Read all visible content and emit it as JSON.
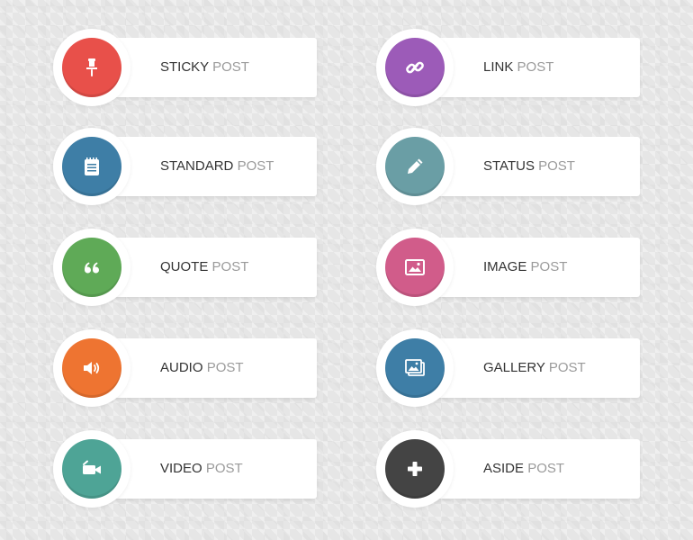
{
  "post_types": [
    {
      "key": "sticky",
      "name": "STICKY",
      "suffix": "POST",
      "icon": "pushpin-icon",
      "color": "#e8504a"
    },
    {
      "key": "link",
      "name": "LINK",
      "suffix": "POST",
      "icon": "link-icon",
      "color": "#9c5bb8"
    },
    {
      "key": "standard",
      "name": "STANDARD",
      "suffix": "POST",
      "icon": "notepad-icon",
      "color": "#3e7ea6"
    },
    {
      "key": "status",
      "name": "STATUS",
      "suffix": "POST",
      "icon": "pencil-icon",
      "color": "#6a9ea5"
    },
    {
      "key": "quote",
      "name": "QUOTE",
      "suffix": "POST",
      "icon": "quote-marks-icon",
      "color": "#5faa57"
    },
    {
      "key": "image",
      "name": "IMAGE",
      "suffix": "POST",
      "icon": "picture-icon",
      "color": "#d15c8a"
    },
    {
      "key": "audio",
      "name": "AUDIO",
      "suffix": "POST",
      "icon": "speaker-icon",
      "color": "#ee7431"
    },
    {
      "key": "gallery",
      "name": "GALLERY",
      "suffix": "POST",
      "icon": "gallery-pictures-icon",
      "color": "#3e7ea6"
    },
    {
      "key": "video",
      "name": "VIDEO",
      "suffix": "POST",
      "icon": "video-camera-icon",
      "color": "#4ea496"
    },
    {
      "key": "aside",
      "name": "ASIDE",
      "suffix": "POST",
      "icon": "plus-icon",
      "color": "#444444"
    }
  ]
}
